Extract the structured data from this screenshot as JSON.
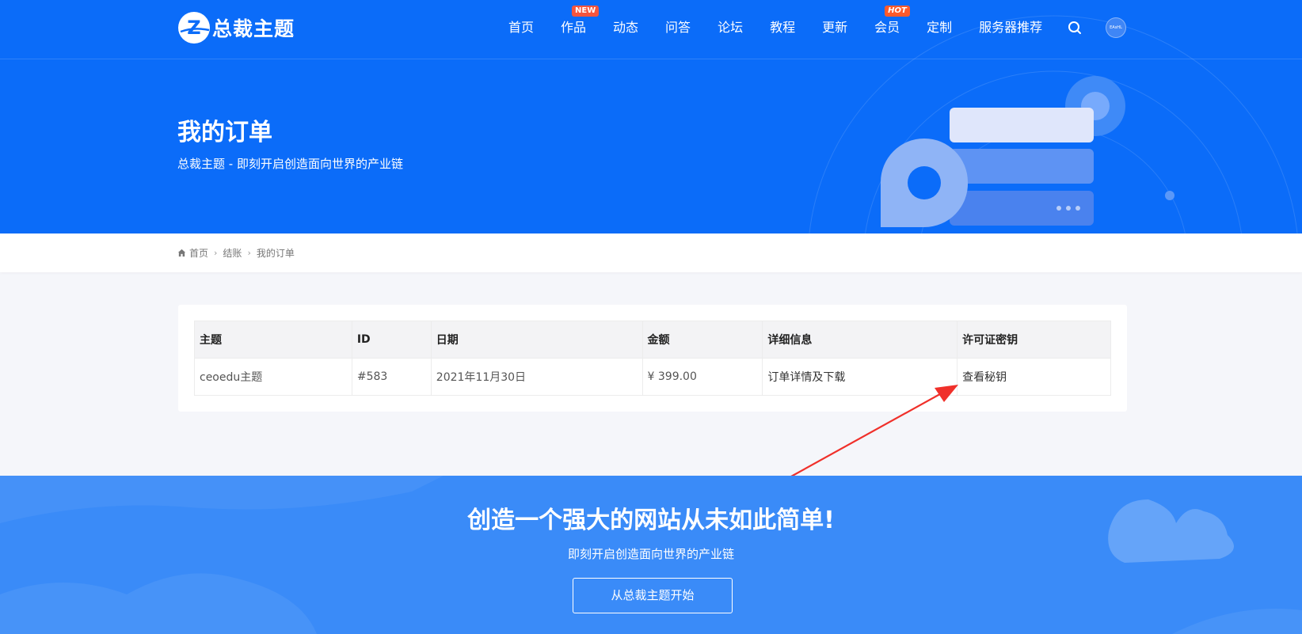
{
  "header": {
    "logo_text": "总裁主题",
    "logo_letter": "Z",
    "nav": [
      {
        "label": "首页",
        "badge": ""
      },
      {
        "label": "作品",
        "badge": "NEW"
      },
      {
        "label": "动态",
        "badge": ""
      },
      {
        "label": "问答",
        "badge": ""
      },
      {
        "label": "论坛",
        "badge": ""
      },
      {
        "label": "教程",
        "badge": ""
      },
      {
        "label": "更新",
        "badge": ""
      },
      {
        "label": "会员",
        "badge": "HOT"
      },
      {
        "label": "定制",
        "badge": ""
      },
      {
        "label": "服务器推荐",
        "badge": ""
      }
    ],
    "avatar_text": "EAsHL"
  },
  "hero": {
    "title": "我的订单",
    "subtitle": "总裁主题 - 即刻开启创造面向世界的产业链"
  },
  "breadcrumb": [
    "首页",
    "结账",
    "我的订单"
  ],
  "orders": {
    "columns": [
      "主题",
      "ID",
      "日期",
      "金额",
      "详细信息",
      "许可证密钥"
    ],
    "rows": [
      {
        "theme": "ceoedu主题",
        "id": "#583",
        "date": "2021年11月30日",
        "amount": "¥ 399.00",
        "details": "订单详情及下载",
        "license": "查看秘钥"
      }
    ]
  },
  "cta": {
    "title": "创造一个强大的网站从未如此简单!",
    "subtitle": "即刻开启创造面向世界的产业链",
    "button": "从总裁主题开始"
  },
  "colors": {
    "primary": "#0b6cf9",
    "cta_bg": "#3a8bf8",
    "badge_red": "#f6553e",
    "arrow_red": "#f0302a"
  },
  "icons": [
    "logo-z-icon",
    "search-icon",
    "home-icon",
    "arrow-annotation"
  ]
}
